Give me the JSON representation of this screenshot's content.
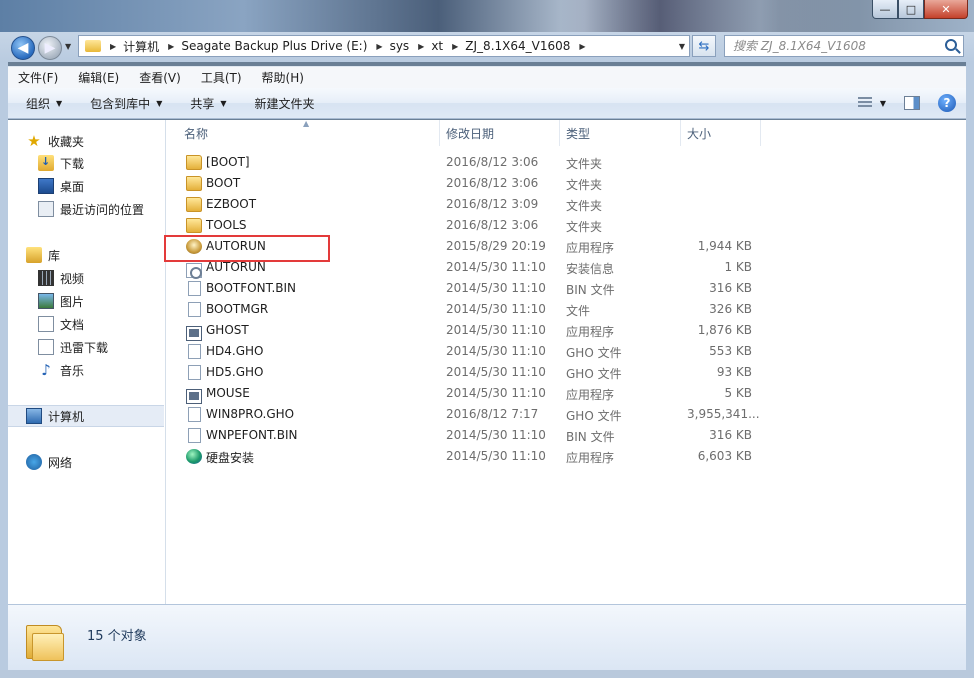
{
  "window": {
    "minimize": "—",
    "maximize": "□",
    "close": "✕"
  },
  "address": {
    "breadcrumbs": [
      "计算机",
      "Seagate Backup Plus Drive (E:)",
      "sys",
      "xt",
      "ZJ_8.1X64_V1608"
    ],
    "search_placeholder": "搜索 ZJ_8.1X64_V1608"
  },
  "menubar": [
    "文件(F)",
    "编辑(E)",
    "查看(V)",
    "工具(T)",
    "帮助(H)"
  ],
  "commands": {
    "organize": "组织",
    "include_library": "包含到库中",
    "share": "共享",
    "new_folder": "新建文件夹"
  },
  "nav": {
    "favorites": "收藏夹",
    "downloads": "下载",
    "desktop": "桌面",
    "recent": "最近访问的位置",
    "libraries": "库",
    "videos": "视频",
    "pictures": "图片",
    "documents": "文档",
    "thunder": "迅雷下载",
    "music": "音乐",
    "computer": "计算机",
    "network": "网络"
  },
  "columns": {
    "name": "名称",
    "date": "修改日期",
    "type": "类型",
    "size": "大小"
  },
  "files": [
    {
      "name": "[BOOT]",
      "date": "2016/8/12 3:06",
      "type": "文件夹",
      "size": "",
      "icon": "folder-icon"
    },
    {
      "name": "BOOT",
      "date": "2016/8/12 3:06",
      "type": "文件夹",
      "size": "",
      "icon": "folder-icon"
    },
    {
      "name": "EZBOOT",
      "date": "2016/8/12 3:09",
      "type": "文件夹",
      "size": "",
      "icon": "folder-icon"
    },
    {
      "name": "TOOLS",
      "date": "2016/8/12 3:06",
      "type": "文件夹",
      "size": "",
      "icon": "folder-icon"
    },
    {
      "name": "AUTORUN",
      "date": "2015/8/29 20:19",
      "type": "应用程序",
      "size": "1,944 KB",
      "icon": "setup-icon"
    },
    {
      "name": "AUTORUN",
      "date": "2014/5/30 11:10",
      "type": "安装信息",
      "size": "1 KB",
      "icon": "setup-info-icon"
    },
    {
      "name": "BOOTFONT.BIN",
      "date": "2014/5/30 11:10",
      "type": "BIN 文件",
      "size": "316 KB",
      "icon": "file-icon"
    },
    {
      "name": "BOOTMGR",
      "date": "2014/5/30 11:10",
      "type": "文件",
      "size": "326 KB",
      "icon": "file-icon"
    },
    {
      "name": "GHOST",
      "date": "2014/5/30 11:10",
      "type": "应用程序",
      "size": "1,876 KB",
      "icon": "app-icon"
    },
    {
      "name": "HD4.GHO",
      "date": "2014/5/30 11:10",
      "type": "GHO 文件",
      "size": "553 KB",
      "icon": "file-icon"
    },
    {
      "name": "HD5.GHO",
      "date": "2014/5/30 11:10",
      "type": "GHO 文件",
      "size": "93 KB",
      "icon": "file-icon"
    },
    {
      "name": "MOUSE",
      "date": "2014/5/30 11:10",
      "type": "应用程序",
      "size": "5 KB",
      "icon": "app-icon"
    },
    {
      "name": "WIN8PRO.GHO",
      "date": "2016/8/12 7:17",
      "type": "GHO 文件",
      "size": "3,955,341...",
      "icon": "file-icon"
    },
    {
      "name": "WNPEFONT.BIN",
      "date": "2014/5/30 11:10",
      "type": "BIN 文件",
      "size": "316 KB",
      "icon": "file-icon"
    },
    {
      "name": "硬盘安装",
      "date": "2014/5/30 11:10",
      "type": "应用程序",
      "size": "6,603 KB",
      "icon": "disk-installer-icon"
    }
  ],
  "status": {
    "count": "15 个对象"
  }
}
